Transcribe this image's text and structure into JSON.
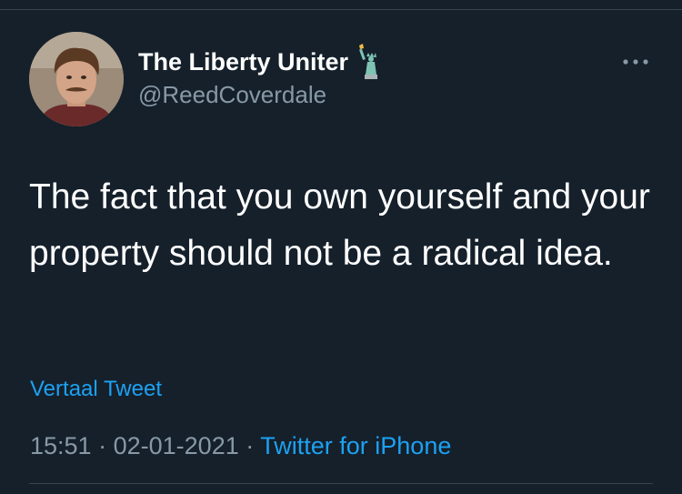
{
  "author": {
    "display_name": "The Liberty Uniter",
    "handle": "@ReedCoverdale",
    "name_emoji": "statue-of-liberty-icon"
  },
  "tweet": {
    "text": "The fact that you own yourself and your property should not be a radical idea.",
    "translate_label": "Vertaal Tweet"
  },
  "meta": {
    "time": "15:51",
    "separator": "·",
    "date": "02-01-2021",
    "source": "Twitter for iPhone"
  },
  "icons": {
    "more": "more-options-icon",
    "avatar": "avatar"
  },
  "colors": {
    "background": "#15202b",
    "text_primary": "#ffffff",
    "text_secondary": "#8899a6",
    "link": "#1da1f2",
    "divider": "#38444d"
  }
}
